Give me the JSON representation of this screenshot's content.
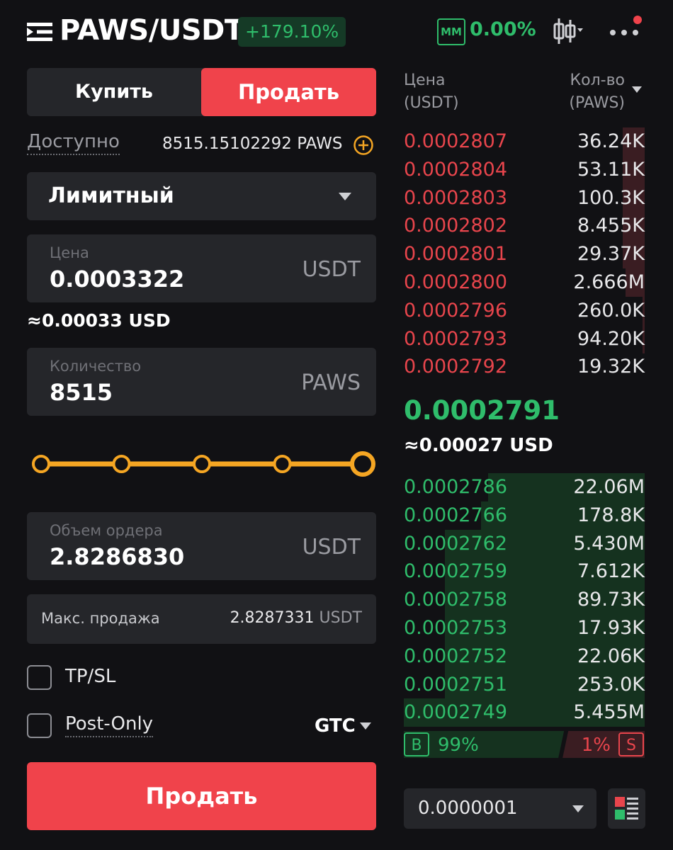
{
  "header": {
    "pair": "PAWS/USDT",
    "change": "+179.10%",
    "mm_badge": "MM",
    "mm_value": "0.00%"
  },
  "form": {
    "tab_buy": "Купить",
    "tab_sell": "Продать",
    "available_label": "Доступно",
    "available_value": "8515.15102292 PAWS",
    "order_type": "Лимитный",
    "price_label": "Цена",
    "price_value": "0.0003322",
    "price_unit": "USDT",
    "price_approx": "≈0.00033 USD",
    "qty_label": "Количество",
    "qty_value": "8515",
    "qty_unit": "PAWS",
    "slider_percent": 100,
    "volume_label": "Объем ордера",
    "volume_value": "2.8286830",
    "volume_unit": "USDT",
    "max_label": "Макс. продажа",
    "max_value": "2.8287331",
    "max_unit": "USDT",
    "tpsl_label": "TP/SL",
    "postonly_label": "Post-Only",
    "tif": "GTC",
    "submit_label": "Продать"
  },
  "orderbook": {
    "price_head_1": "Цена",
    "price_head_2": "(USDT)",
    "qty_head_1": "Кол-во",
    "qty_head_2": "(PAWS)",
    "asks": [
      {
        "price": "0.0002807",
        "qty": "36.24K",
        "depth": 0.09
      },
      {
        "price": "0.0002804",
        "qty": "53.11K",
        "depth": 0.09
      },
      {
        "price": "0.0002803",
        "qty": "100.3K",
        "depth": 0.09
      },
      {
        "price": "0.0002802",
        "qty": "8.455K",
        "depth": 0.09
      },
      {
        "price": "0.0002801",
        "qty": "29.37K",
        "depth": 0.09
      },
      {
        "price": "0.0002800",
        "qty": "2.666M",
        "depth": 0.08
      },
      {
        "price": "0.0002796",
        "qty": "260.0K",
        "depth": 0.01
      },
      {
        "price": "0.0002793",
        "qty": "94.20K",
        "depth": 0.01
      },
      {
        "price": "0.0002792",
        "qty": "19.32K",
        "depth": 0.0
      }
    ],
    "last_price": "0.0002791",
    "last_usd": "≈0.00027 USD",
    "bids": [
      {
        "price": "0.0002786",
        "qty": "22.06M",
        "depth": 0.65
      },
      {
        "price": "0.0002766",
        "qty": "178.8K",
        "depth": 0.68
      },
      {
        "price": "0.0002762",
        "qty": "5.430M",
        "depth": 0.83
      },
      {
        "price": "0.0002759",
        "qty": "7.612K",
        "depth": 0.83
      },
      {
        "price": "0.0002758",
        "qty": "89.73K",
        "depth": 0.83
      },
      {
        "price": "0.0002753",
        "qty": "17.93K",
        "depth": 0.83
      },
      {
        "price": "0.0002752",
        "qty": "22.06K",
        "depth": 0.83
      },
      {
        "price": "0.0002751",
        "qty": "253.0K",
        "depth": 0.83
      },
      {
        "price": "0.0002749",
        "qty": "5.455M",
        "depth": 1.0
      }
    ],
    "buy_badge": "B",
    "buy_ratio": "99%",
    "sell_ratio": "1%",
    "sell_badge": "S",
    "buy_ratio_value": 0.99,
    "tick_size": "0.0000001"
  },
  "colors": {
    "sell": "#f0434b",
    "buy": "#2fbd6b",
    "accent": "#f5a623"
  }
}
